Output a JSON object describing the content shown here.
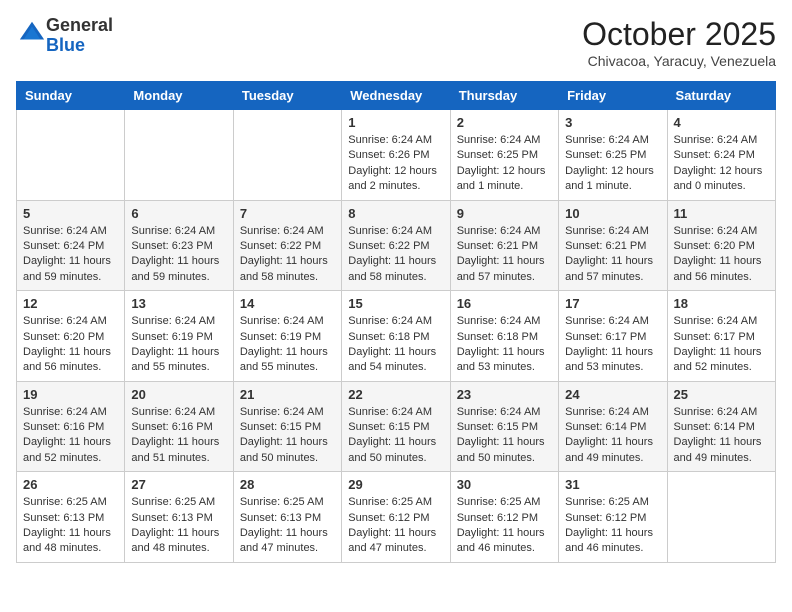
{
  "logo": {
    "general": "General",
    "blue": "Blue"
  },
  "header": {
    "month": "October 2025",
    "subtitle": "Chivacoa, Yaracuy, Venezuela"
  },
  "days_of_week": [
    "Sunday",
    "Monday",
    "Tuesday",
    "Wednesday",
    "Thursday",
    "Friday",
    "Saturday"
  ],
  "weeks": [
    [
      {
        "day": "",
        "info": ""
      },
      {
        "day": "",
        "info": ""
      },
      {
        "day": "",
        "info": ""
      },
      {
        "day": "1",
        "info": "Sunrise: 6:24 AM\nSunset: 6:26 PM\nDaylight: 12 hours\nand 2 minutes."
      },
      {
        "day": "2",
        "info": "Sunrise: 6:24 AM\nSunset: 6:25 PM\nDaylight: 12 hours\nand 1 minute."
      },
      {
        "day": "3",
        "info": "Sunrise: 6:24 AM\nSunset: 6:25 PM\nDaylight: 12 hours\nand 1 minute."
      },
      {
        "day": "4",
        "info": "Sunrise: 6:24 AM\nSunset: 6:24 PM\nDaylight: 12 hours\nand 0 minutes."
      }
    ],
    [
      {
        "day": "5",
        "info": "Sunrise: 6:24 AM\nSunset: 6:24 PM\nDaylight: 11 hours\nand 59 minutes."
      },
      {
        "day": "6",
        "info": "Sunrise: 6:24 AM\nSunset: 6:23 PM\nDaylight: 11 hours\nand 59 minutes."
      },
      {
        "day": "7",
        "info": "Sunrise: 6:24 AM\nSunset: 6:22 PM\nDaylight: 11 hours\nand 58 minutes."
      },
      {
        "day": "8",
        "info": "Sunrise: 6:24 AM\nSunset: 6:22 PM\nDaylight: 11 hours\nand 58 minutes."
      },
      {
        "day": "9",
        "info": "Sunrise: 6:24 AM\nSunset: 6:21 PM\nDaylight: 11 hours\nand 57 minutes."
      },
      {
        "day": "10",
        "info": "Sunrise: 6:24 AM\nSunset: 6:21 PM\nDaylight: 11 hours\nand 57 minutes."
      },
      {
        "day": "11",
        "info": "Sunrise: 6:24 AM\nSunset: 6:20 PM\nDaylight: 11 hours\nand 56 minutes."
      }
    ],
    [
      {
        "day": "12",
        "info": "Sunrise: 6:24 AM\nSunset: 6:20 PM\nDaylight: 11 hours\nand 56 minutes."
      },
      {
        "day": "13",
        "info": "Sunrise: 6:24 AM\nSunset: 6:19 PM\nDaylight: 11 hours\nand 55 minutes."
      },
      {
        "day": "14",
        "info": "Sunrise: 6:24 AM\nSunset: 6:19 PM\nDaylight: 11 hours\nand 55 minutes."
      },
      {
        "day": "15",
        "info": "Sunrise: 6:24 AM\nSunset: 6:18 PM\nDaylight: 11 hours\nand 54 minutes."
      },
      {
        "day": "16",
        "info": "Sunrise: 6:24 AM\nSunset: 6:18 PM\nDaylight: 11 hours\nand 53 minutes."
      },
      {
        "day": "17",
        "info": "Sunrise: 6:24 AM\nSunset: 6:17 PM\nDaylight: 11 hours\nand 53 minutes."
      },
      {
        "day": "18",
        "info": "Sunrise: 6:24 AM\nSunset: 6:17 PM\nDaylight: 11 hours\nand 52 minutes."
      }
    ],
    [
      {
        "day": "19",
        "info": "Sunrise: 6:24 AM\nSunset: 6:16 PM\nDaylight: 11 hours\nand 52 minutes."
      },
      {
        "day": "20",
        "info": "Sunrise: 6:24 AM\nSunset: 6:16 PM\nDaylight: 11 hours\nand 51 minutes."
      },
      {
        "day": "21",
        "info": "Sunrise: 6:24 AM\nSunset: 6:15 PM\nDaylight: 11 hours\nand 50 minutes."
      },
      {
        "day": "22",
        "info": "Sunrise: 6:24 AM\nSunset: 6:15 PM\nDaylight: 11 hours\nand 50 minutes."
      },
      {
        "day": "23",
        "info": "Sunrise: 6:24 AM\nSunset: 6:15 PM\nDaylight: 11 hours\nand 50 minutes."
      },
      {
        "day": "24",
        "info": "Sunrise: 6:24 AM\nSunset: 6:14 PM\nDaylight: 11 hours\nand 49 minutes."
      },
      {
        "day": "25",
        "info": "Sunrise: 6:24 AM\nSunset: 6:14 PM\nDaylight: 11 hours\nand 49 minutes."
      }
    ],
    [
      {
        "day": "26",
        "info": "Sunrise: 6:25 AM\nSunset: 6:13 PM\nDaylight: 11 hours\nand 48 minutes."
      },
      {
        "day": "27",
        "info": "Sunrise: 6:25 AM\nSunset: 6:13 PM\nDaylight: 11 hours\nand 48 minutes."
      },
      {
        "day": "28",
        "info": "Sunrise: 6:25 AM\nSunset: 6:13 PM\nDaylight: 11 hours\nand 47 minutes."
      },
      {
        "day": "29",
        "info": "Sunrise: 6:25 AM\nSunset: 6:12 PM\nDaylight: 11 hours\nand 47 minutes."
      },
      {
        "day": "30",
        "info": "Sunrise: 6:25 AM\nSunset: 6:12 PM\nDaylight: 11 hours\nand 46 minutes."
      },
      {
        "day": "31",
        "info": "Sunrise: 6:25 AM\nSunset: 6:12 PM\nDaylight: 11 hours\nand 46 minutes."
      },
      {
        "day": "",
        "info": ""
      }
    ]
  ]
}
